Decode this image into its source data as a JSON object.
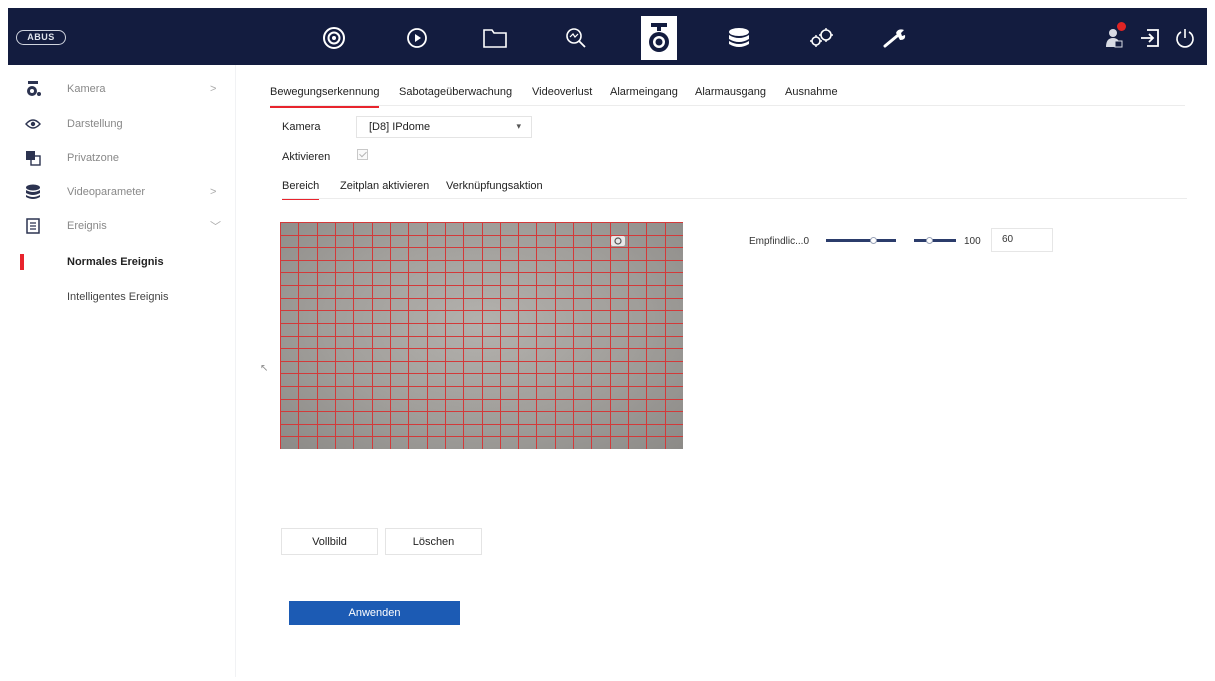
{
  "brand": "ABUS",
  "topnav": {
    "items": [
      {
        "icon": "live-view-icon"
      },
      {
        "icon": "playback-icon"
      },
      {
        "icon": "file-folder-icon"
      },
      {
        "icon": "search-icon"
      },
      {
        "icon": "camera-icon",
        "active": true
      },
      {
        "icon": "storage-icon"
      },
      {
        "icon": "system-config-icon"
      },
      {
        "icon": "maintenance-wrench-icon"
      }
    ],
    "right": [
      "alarm-user-icon",
      "logout-icon",
      "power-icon"
    ]
  },
  "sidebar": {
    "items": [
      {
        "label": "Kamera",
        "icon": "camera-icon",
        "chevron": ">"
      },
      {
        "label": "Darstellung",
        "icon": "eye-icon",
        "chevron": ""
      },
      {
        "label": "Privatzone",
        "icon": "privacy-mask-icon",
        "chevron": ""
      },
      {
        "label": "Videoparameter",
        "icon": "database-icon",
        "chevron": ">"
      },
      {
        "label": "Ereignis",
        "icon": "event-document-icon",
        "chevron": "﹀"
      },
      {
        "label": "Normales Ereignis"
      },
      {
        "label": "Intelligentes Ereignis"
      }
    ]
  },
  "tabs": [
    "Bewegungserkennung",
    "Sabotageüberwachung",
    "Videoverlust",
    "Alarmeingang",
    "Alarmausgang",
    "Ausnahme"
  ],
  "form": {
    "camera_label": "Kamera",
    "camera_value": "[D8] IPdome",
    "enable_label": "Aktivieren",
    "enabled": true
  },
  "subtabs": [
    "Bereich",
    "Zeitplan aktivieren",
    "Verknüpfungsaktion"
  ],
  "sensitivity": {
    "label": "Empfindlic...0",
    "max_label": "100",
    "value": "60",
    "level": 0.6
  },
  "buttons": {
    "fullscreen": "Vollbild",
    "clear": "Löschen",
    "apply": "Anwenden"
  },
  "colors": {
    "topbar": "#131c3f",
    "accent_red": "#e8242d",
    "primary_blue": "#1c5bb4",
    "grid_line": "#d23a3a"
  }
}
